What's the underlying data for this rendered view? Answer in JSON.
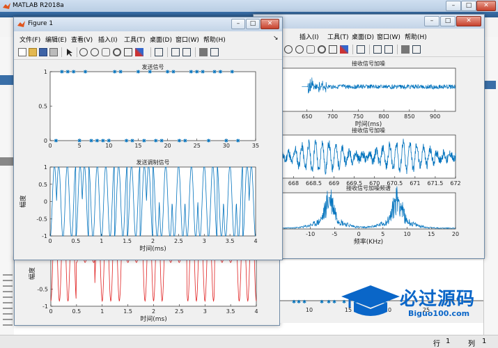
{
  "matlab": {
    "title": "MATLAB R2018a",
    "status": {
      "line_label": "行",
      "line_value": "1",
      "col_label": "列",
      "col_value": "1"
    }
  },
  "figure1": {
    "title": "Figure 1",
    "menu": [
      "文件(F)",
      "编辑(E)",
      "查看(V)",
      "插入(I)",
      "工具(T)",
      "桌面(D)",
      "窗口(W)",
      "帮助(H)"
    ]
  },
  "figure2": {
    "menu": [
      "插入(I)",
      "工具(T)",
      "桌面(D)",
      "窗口(W)",
      "帮助(H)"
    ]
  },
  "watermark": {
    "text": "必过源码",
    "url": "Biguo100.com"
  },
  "colors": {
    "series_blue": "#0072bd",
    "series_red": "#e02020",
    "accent_blue": "#0066cc"
  },
  "chart_data": [
    {
      "type": "scatter",
      "title": "发送信号",
      "xlabel": "",
      "ylabel": "",
      "xlim": [
        0,
        35
      ],
      "ylim": [
        0,
        1
      ],
      "xticks": [
        "0",
        "5",
        "10",
        "15",
        "20",
        "25",
        "30",
        "35"
      ],
      "yticks": [
        "0",
        "0.5",
        "1"
      ],
      "x": [
        1,
        2,
        3,
        4,
        5,
        6,
        7,
        8,
        9,
        10,
        11,
        12,
        13,
        14,
        15,
        16,
        17,
        18,
        19,
        20,
        21,
        22,
        23,
        24,
        25,
        26,
        27,
        28,
        29,
        30,
        31,
        32
      ],
      "y": [
        0,
        1,
        1,
        1,
        0,
        1,
        0,
        0,
        0,
        0,
        1,
        1,
        0,
        0,
        1,
        0,
        1,
        0,
        0,
        1,
        1,
        0,
        0,
        1,
        1,
        1,
        0,
        1,
        1,
        0,
        1,
        0
      ]
    },
    {
      "type": "line",
      "title": "发送调制信号",
      "xlabel": "时间(ms)",
      "ylabel": "幅度",
      "xlim": [
        0,
        4
      ],
      "ylim": [
        -1,
        1
      ],
      "xticks": [
        "0",
        "0.5",
        "1",
        "1.5",
        "2",
        "2.5",
        "3",
        "3.5",
        "4"
      ],
      "yticks": [
        "-1",
        "-0.5",
        "0",
        "0.5",
        "1"
      ]
    },
    {
      "type": "line",
      "title": "",
      "xlabel": "时间(ms)",
      "ylabel": "幅度",
      "xlim": [
        0,
        4
      ],
      "ylim": [
        -1,
        1
      ],
      "xticks": [
        "0",
        "0.5",
        "1",
        "1.5",
        "2",
        "2.5",
        "3",
        "3.5",
        "4"
      ],
      "yticks": [
        "-1",
        "-0.5",
        "0",
        "0.5",
        "1"
      ]
    },
    {
      "type": "line",
      "title": "接收信号加噪",
      "xlabel": "时间(ms)",
      "ylabel": "",
      "xlim": [
        600,
        940
      ],
      "xticks": [
        "650",
        "700",
        "750",
        "800",
        "850",
        "900"
      ]
    },
    {
      "type": "line",
      "title": "接收信号加噪",
      "xlabel": "",
      "ylabel": "",
      "xlim": [
        667.7,
        672
      ],
      "xticks": [
        "668",
        "668.5",
        "669",
        "669.5",
        "670",
        "670.5",
        "671",
        "671.5",
        "672"
      ]
    },
    {
      "type": "line",
      "title": "接收信号加噪频谱",
      "xlabel": "频率(KHz)",
      "ylabel": "",
      "xlim": [
        -16,
        20
      ],
      "xticks": [
        "-10",
        "-5",
        "0",
        "5",
        "10",
        "15",
        "20"
      ]
    },
    {
      "type": "scatter",
      "title": "",
      "xlabel": "",
      "ylabel": "",
      "xticks": [
        "10",
        "15",
        "20",
        "25"
      ]
    }
  ]
}
